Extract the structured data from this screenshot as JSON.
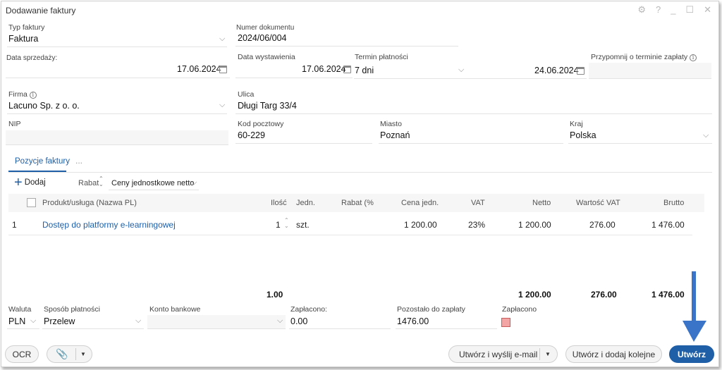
{
  "window": {
    "title": "Dodawanie faktury",
    "controls": [
      "⚙",
      "?",
      "_",
      "☐",
      "✕"
    ]
  },
  "header": {
    "doc_type_label": "Typ faktury",
    "doc_type_value": "Faktura",
    "doc_number_label": "Numer dokumentu",
    "doc_number_value": "2024/06/004",
    "sale_date_label": "Data sprzedaży:",
    "sale_date_value": "17.06.2024",
    "issue_date_label": "Data wystawienia",
    "issue_date_value": "17.06.2024",
    "payment_term_label": "Termin płatności",
    "payment_term_value": "7 dni",
    "due_date_value": "24.06.2024",
    "reminder_label": "Przypomnij o terminie zapłaty"
  },
  "buyer": {
    "company_label": "Firma",
    "company_value": "Lacuno Sp. z o. o.",
    "street_label": "Ulica",
    "street_value": "Długi Targ 33/4",
    "nip_label": "NIP",
    "nip_value": "",
    "postal_label": "Kod pocztowy",
    "postal_value": "60-229",
    "city_label": "Miasto",
    "city_value": "Poznań",
    "country_label": "Kraj",
    "country_value": "Polska"
  },
  "tabs": {
    "active": "Pozycje faktury",
    "more": "..."
  },
  "toolbar": {
    "add_label": "Dodaj",
    "discount_label": "Rabat",
    "price_mode": "Ceny jednostkowe netto"
  },
  "table": {
    "headers": {
      "product": "Produkt/usługa (Nazwa PL)",
      "qty": "Ilość",
      "unit": "Jedn.",
      "discount": "Rabat (%",
      "unit_price": "Cena jedn.",
      "vat": "VAT",
      "net": "Netto",
      "vat_value": "Wartość VAT",
      "gross": "Brutto"
    },
    "rows": [
      {
        "lp": "1",
        "product": "Dostęp do platformy e-learningowej",
        "qty": "1",
        "unit": "szt.",
        "discount": "",
        "unit_price": "1 200.00",
        "vat": "23%",
        "net": "1 200.00",
        "vat_value": "276.00",
        "gross": "1 476.00"
      }
    ],
    "totals": {
      "qty": "1.00",
      "net": "1 200.00",
      "vat_value": "276.00",
      "gross": "1 476.00"
    }
  },
  "payment": {
    "currency_label": "Waluta",
    "currency_value": "PLN",
    "method_label": "Sposób płatności",
    "method_value": "Przelew",
    "account_label": "Konto bankowe",
    "account_value": "",
    "paid_label": "Zapłacono:",
    "paid_value": "0.00",
    "remaining_label": "Pozostało do zapłaty",
    "remaining_value": "1476.00",
    "paid_flag_label": "Zapłacono"
  },
  "footer": {
    "ocr_label": "OCR",
    "create_send_label": "Utwórz i wyślij e-mail",
    "create_next_label": "Utwórz i dodaj kolejne",
    "create_label": "Utwórz"
  },
  "colors": {
    "accent": "#1f5fa7",
    "arrow": "#3a74c9",
    "paid_flag": "#f3a4a4"
  }
}
